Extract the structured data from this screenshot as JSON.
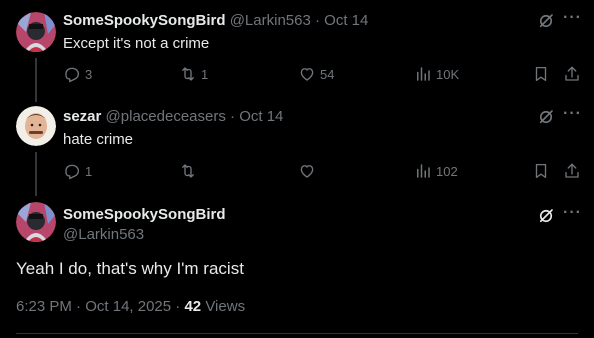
{
  "tweets": [
    {
      "display_name": "SomeSpookySongBird",
      "handle": "@Larkin563",
      "date": "Oct 14",
      "text": "Except it's not a crime",
      "replies": "3",
      "reposts": "1",
      "likes": "54",
      "views": "10K"
    },
    {
      "display_name": "sezar",
      "handle": "@placedeceasers",
      "date": "Oct 14",
      "text": "hate crime",
      "replies": "1",
      "reposts": "",
      "likes": "",
      "views": "102"
    }
  ],
  "main_tweet": {
    "display_name": "SomeSpookySongBird",
    "handle": "@Larkin563",
    "text": "Yeah I do, that's why I'm racist",
    "time": "6:23 PM",
    "date": "Oct 14, 2025",
    "views_count": "42",
    "views_label": "Views"
  },
  "icons": [
    "grok-icon",
    "more-icon",
    "reply-icon",
    "repost-icon",
    "like-icon",
    "views-icon",
    "bookmark-icon",
    "share-icon"
  ],
  "colors": {
    "background": "#000000",
    "text": "#e7e9ea",
    "muted": "#71767b",
    "thread_line": "#333639"
  }
}
